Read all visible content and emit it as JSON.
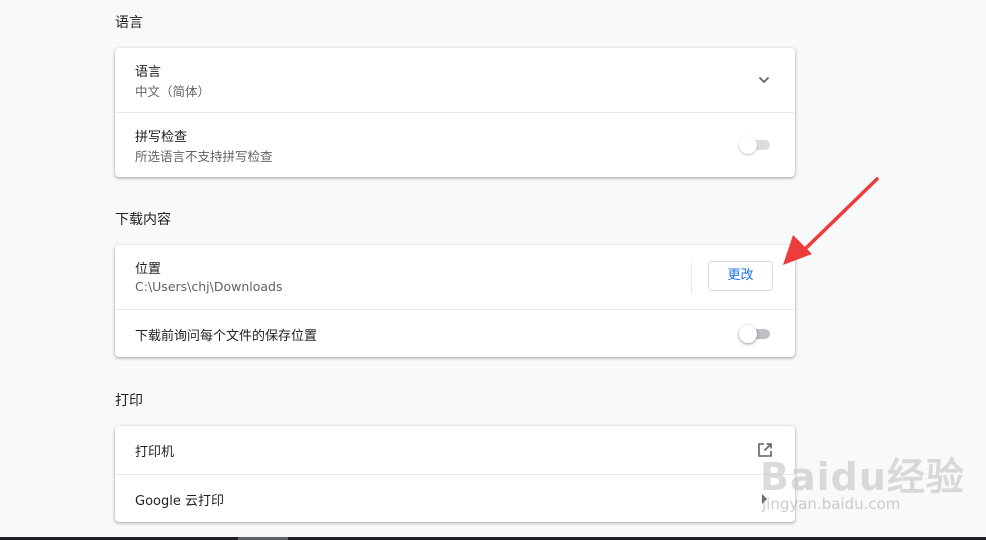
{
  "sections": {
    "language": {
      "title": "语言",
      "language_row": {
        "title": "语言",
        "value": "中文（简体）"
      },
      "spellcheck_row": {
        "title": "拼写检查",
        "subtitle": "所选语言不支持拼写检查",
        "enabled": false
      }
    },
    "downloads": {
      "title": "下载内容",
      "location_row": {
        "title": "位置",
        "path": "C:\\Users\\chj\\Downloads",
        "change_label": "更改"
      },
      "ask_row": {
        "title": "下载前询问每个文件的保存位置",
        "enabled": false
      }
    },
    "printing": {
      "title": "打印",
      "printers_row": {
        "title": "打印机"
      },
      "cloud_print_row": {
        "title": "Google 云打印"
      }
    }
  },
  "watermark": {
    "brand": "Baidu经验",
    "url": "jingyan.baidu.com"
  },
  "colors": {
    "background": "#f8f9fa",
    "card": "#ffffff",
    "accent": "#1a73e8",
    "annotation_arrow": "#ee3b3b"
  },
  "icons": {
    "language_expand": "chevron-down-icon",
    "printers_external": "open-in-new-icon",
    "cloud_print_nav": "arrow-right-icon"
  }
}
